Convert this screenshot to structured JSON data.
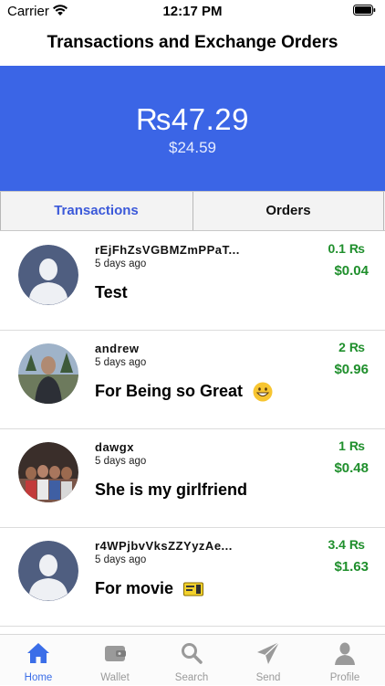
{
  "status_bar": {
    "carrier": "Carrier",
    "time": "12:17 PM"
  },
  "header": {
    "title": "Transactions and Exchange Orders"
  },
  "balance": {
    "primary": "₨47.29",
    "secondary": "$24.59"
  },
  "tabs": [
    {
      "label": "Transactions",
      "active": true
    },
    {
      "label": "Orders",
      "active": false
    }
  ],
  "transactions": [
    {
      "sender": "rEjFhZsVGBMZmPPaT...",
      "time": "5 days ago",
      "memo": "Test",
      "amount_xrp": "0.1 ₨",
      "amount_usd": "$0.04"
    },
    {
      "sender": "andrew",
      "time": "5 days ago",
      "memo": "For Being so Great",
      "amount_xrp": "2 ₨",
      "amount_usd": "$0.96"
    },
    {
      "sender": "dawgx",
      "time": "5 days ago",
      "memo": "She is my girlfriend",
      "amount_xrp": "1 ₨",
      "amount_usd": "$0.48"
    },
    {
      "sender": "r4WPjbvVksZZYyzAe...",
      "time": "5 days ago",
      "memo": "For movie",
      "amount_xrp": "3.4 ₨",
      "amount_usd": "$1.63"
    }
  ],
  "tabbar": [
    {
      "label": "Home",
      "icon": "home-icon",
      "active": true
    },
    {
      "label": "Wallet",
      "icon": "wallet-icon",
      "active": false
    },
    {
      "label": "Search",
      "icon": "search-icon",
      "active": false
    },
    {
      "label": "Send",
      "icon": "send-icon",
      "active": false
    },
    {
      "label": "Profile",
      "icon": "profile-icon",
      "active": false
    }
  ],
  "colors": {
    "accent": "#3b65e6",
    "positive": "#1f8f2c",
    "tab_active": "#3b6ee8",
    "tab_inactive": "#9a9a9a"
  }
}
